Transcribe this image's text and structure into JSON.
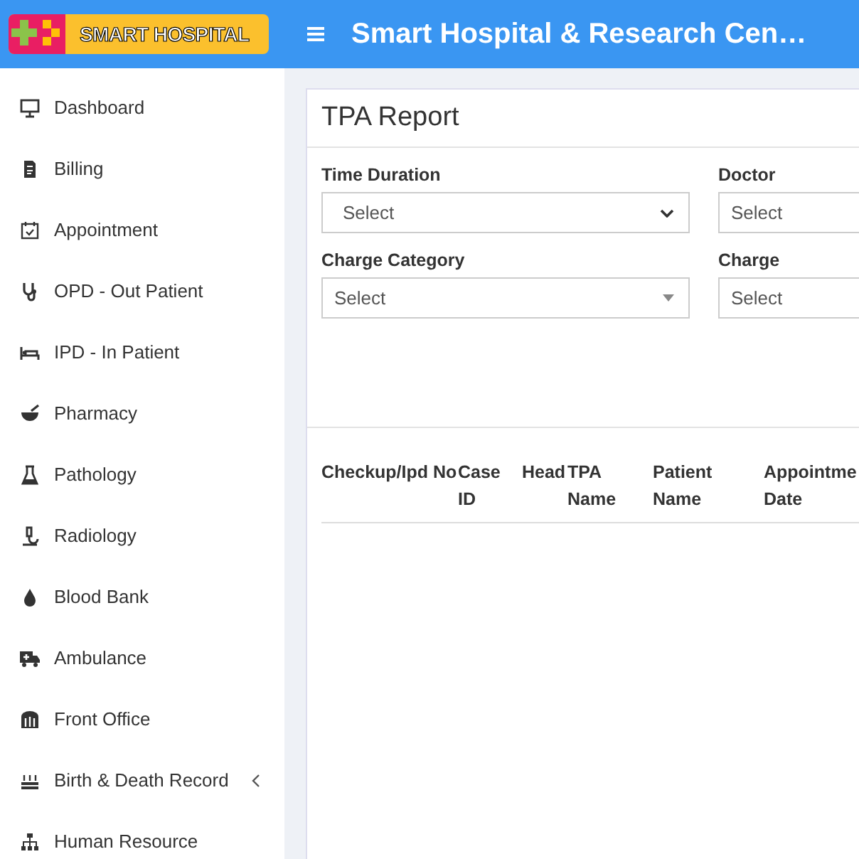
{
  "header": {
    "logo_text": "SMART HOSPITAL",
    "title": "Smart Hospital & Research Cen…"
  },
  "sidebar": {
    "items": [
      {
        "label": "Dashboard",
        "has_submenu": false
      },
      {
        "label": "Billing",
        "has_submenu": false
      },
      {
        "label": "Appointment",
        "has_submenu": false
      },
      {
        "label": "OPD - Out Patient",
        "has_submenu": false
      },
      {
        "label": "IPD - In Patient",
        "has_submenu": false
      },
      {
        "label": "Pharmacy",
        "has_submenu": false
      },
      {
        "label": "Pathology",
        "has_submenu": false
      },
      {
        "label": "Radiology",
        "has_submenu": false
      },
      {
        "label": "Blood Bank",
        "has_submenu": false
      },
      {
        "label": "Ambulance",
        "has_submenu": false
      },
      {
        "label": "Front Office",
        "has_submenu": false
      },
      {
        "label": "Birth & Death Record",
        "has_submenu": true
      },
      {
        "label": "Human Resource",
        "has_submenu": false
      }
    ]
  },
  "report": {
    "title": "TPA Report",
    "filters": [
      {
        "label": "Time Duration",
        "kind": "native",
        "value": "Select"
      },
      {
        "label": "Doctor",
        "kind": "plain",
        "value": "Select"
      },
      {
        "label": "Charge Category",
        "kind": "dropdown",
        "value": "Select"
      },
      {
        "label": "Charge",
        "kind": "plain",
        "value": "Select"
      }
    ],
    "table": {
      "columns": [
        "Checkup/Ipd No",
        "Case ID",
        "Head",
        "TPA Name",
        "Patient Name",
        "Appointme Date"
      ]
    }
  }
}
